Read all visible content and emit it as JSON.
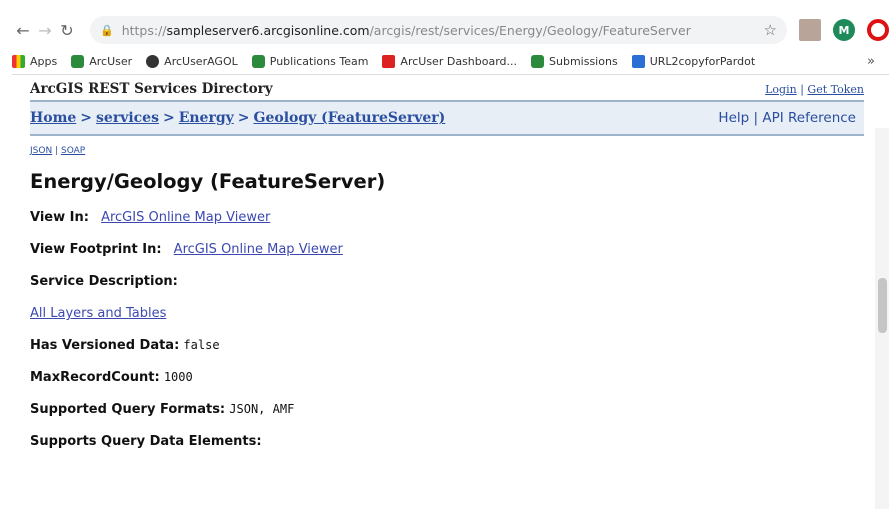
{
  "browser": {
    "url_prefix": "https://",
    "url_host": "sampleserver6.arcgisonline.com",
    "url_path": "/arcgis/rest/services/Energy/Geology/FeatureServer",
    "profile_initial": "M"
  },
  "bookmarks": [
    {
      "label": "Apps",
      "icon": "apps-grid-icon"
    },
    {
      "label": "ArcUser",
      "icon": "globe-icon"
    },
    {
      "label": "ArcUserAGOL",
      "icon": "globe-icon"
    },
    {
      "label": "Publications Team",
      "icon": "globe-icon"
    },
    {
      "label": "ArcUser Dashboard...",
      "icon": "dashboard-icon"
    },
    {
      "label": "Submissions",
      "icon": "globe-icon"
    },
    {
      "label": "URL2copyforPardot",
      "icon": "bookmark-icon"
    }
  ],
  "header": {
    "directory_title": "ArcGIS REST Services Directory",
    "login": "Login",
    "auth_sep": "|",
    "get_token": "Get Token"
  },
  "breadcrumb": {
    "home": "Home",
    "services": "services",
    "energy": "Energy",
    "current": "Geology (FeatureServer)",
    "sep": ">"
  },
  "help": {
    "help": "Help",
    "sep": "|",
    "api": "API Reference"
  },
  "formats": {
    "json": "JSON",
    "sep": "|",
    "soap": "SOAP"
  },
  "service": {
    "title": "Energy/Geology (FeatureServer)",
    "view_in_label": "View In:",
    "view_in_link": "ArcGIS Online Map Viewer",
    "view_footprint_label": "View Footprint In:",
    "view_footprint_link": "ArcGIS Online Map Viewer",
    "service_description_label": "Service Description:",
    "all_layers_link": "All Layers and Tables",
    "versioned_label": "Has Versioned Data:",
    "versioned_value": "false",
    "maxrecord_label": "MaxRecordCount:",
    "maxrecord_value": "1000",
    "query_formats_label": "Supported Query Formats:",
    "query_formats_value": "JSON, AMF",
    "query_elements_label": "Supports Query Data Elements:"
  }
}
